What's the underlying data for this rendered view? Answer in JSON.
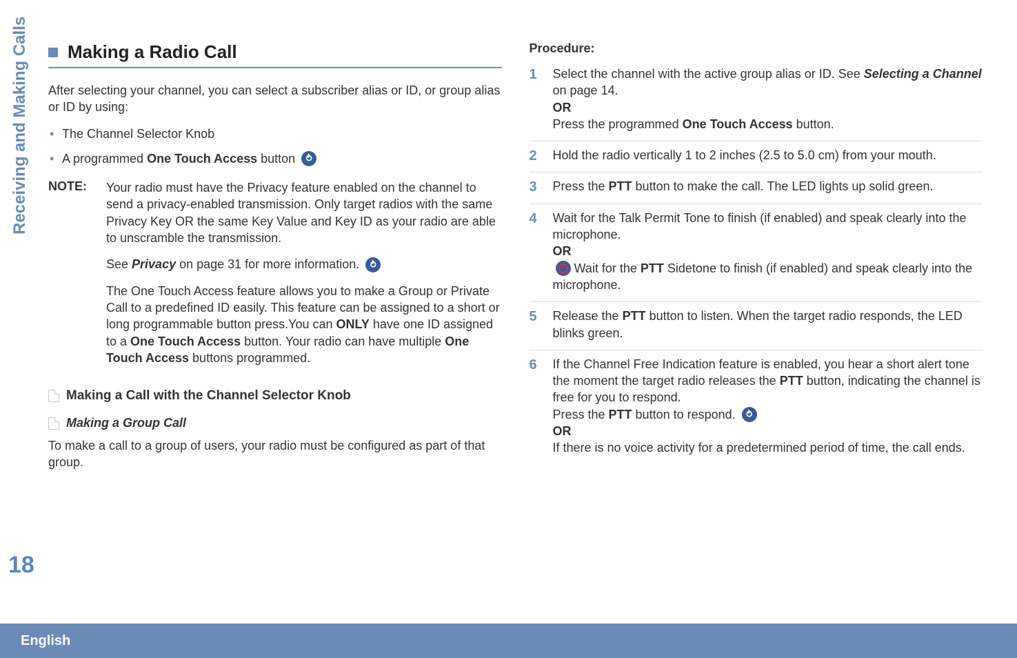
{
  "side": {
    "tab": "Receiving and Making Calls",
    "page_num": "18"
  },
  "footer": {
    "lang": "English"
  },
  "left": {
    "h1": "Making a Radio Call",
    "intro": "After selecting your channel, you can select a subscriber alias or ID, or group alias or ID by using:",
    "bullets": {
      "b1": "The Channel Selector Knob",
      "b2_pre": "A programmed ",
      "b2_bold": "One Touch Access",
      "b2_post": " button"
    },
    "note_label": "NOTE:",
    "note_p1": "Your radio must have the Privacy feature enabled on the channel to send a privacy-enabled transmission. Only target radios with the same Privacy Key OR the same Key Value and Key ID as your radio are able to unscramble the transmission.",
    "note_p2_pre": "See ",
    "note_p2_bi": "Privacy",
    "note_p2_post": " on page 31 for more information.",
    "note_p3_a": "The One Touch Access feature allows you to make a Group or Private Call to a predefined ID easily. This feature can be assigned to a short or long programmable button press.You can ",
    "note_p3_only": "ONLY",
    "note_p3_b": " have one ID assigned to a ",
    "note_p3_ota1": "One Touch Access",
    "note_p3_c": " button. Your radio can have multiple ",
    "note_p3_ota2": "One Touch Access",
    "note_p3_d": " buttons programmed.",
    "h2": "Making a Call with the Channel Selector Knob",
    "h3": "Making a Group Call",
    "group_intro": "To make a call to a group of users, your radio must be configured as part of that group."
  },
  "right": {
    "proc": "Procedure:",
    "s1_a": "Select the channel with the active group alias or ID. See ",
    "s1_bi": "Selecting a Channel",
    "s1_b": " on page 14.",
    "s1_or": "OR",
    "s1_c": "Press the programmed ",
    "s1_ota": "One Touch Access",
    "s1_d": " button.",
    "s2": "Hold the radio vertically 1 to 2 inches (2.5 to 5.0 cm) from your mouth.",
    "s3_a": "Press the ",
    "s3_ptt": "PTT",
    "s3_b": " button to make the call. The LED lights up solid green.",
    "s4_a": "Wait for the Talk Permit Tone to finish (if enabled) and speak clearly into the microphone.",
    "s4_or": "OR",
    "s4_b": " Wait for the ",
    "s4_ptt": "PTT",
    "s4_c": " Sidetone to finish (if enabled) and speak clearly into the microphone.",
    "s5_a": "Release the ",
    "s5_ptt": "PTT",
    "s5_b": " button to listen. When the target radio responds, the LED blinks green.",
    "s6_a": "If the Channel Free Indication feature is enabled, you hear a short alert tone the moment the target radio releases the ",
    "s6_ptt1": "PTT",
    "s6_b": " button, indicating the channel is free for you to respond.",
    "s6_c": "Press the ",
    "s6_ptt2": "PTT",
    "s6_d": " button to respond.",
    "s6_or": "OR",
    "s6_e": "If there is no voice activity for a predetermined period of time, the call ends."
  }
}
